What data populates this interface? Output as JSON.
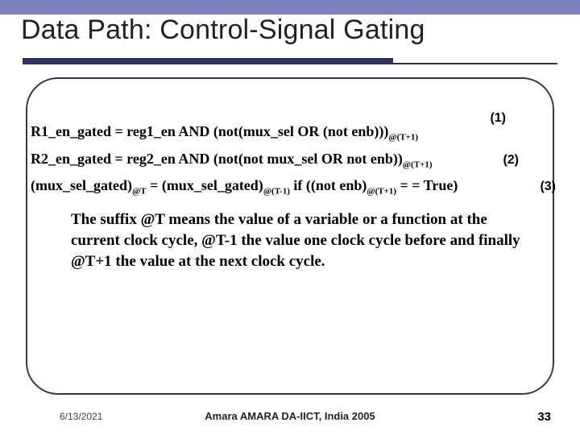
{
  "title": "Data Path: Control-Signal Gating",
  "eq": {
    "line1_a": "R1_en_gated = reg1_en AND (not(mux_sel OR (not enb)))",
    "line1_sub": "@(T+1)",
    "tag1": "(1)",
    "line2_a": "R2_en_gated = reg2_en AND (not(not mux_sel OR not enb))",
    "line2_sub": "@(T+1)",
    "tag2": "(2)",
    "line3_a": "(mux_sel_gated)",
    "line3_sub_a": "@T",
    "line3_b": " = (mux_sel_gated)",
    "line3_sub_b": "@(T-1)",
    "line3_c": " if ((not enb)",
    "line3_sub_c": "@(T+1)",
    "line3_d": " = = True)",
    "tag3": "(3)"
  },
  "explain": "The suffix @T means the value of a variable or a function at the current clock cycle, @T-1 the value one clock cycle before and finally @T+1 the value at the next clock cycle.",
  "footer": {
    "date": "6/13/2021",
    "center": "Amara AMARA DA-IICT, India 2005",
    "page": "33"
  }
}
